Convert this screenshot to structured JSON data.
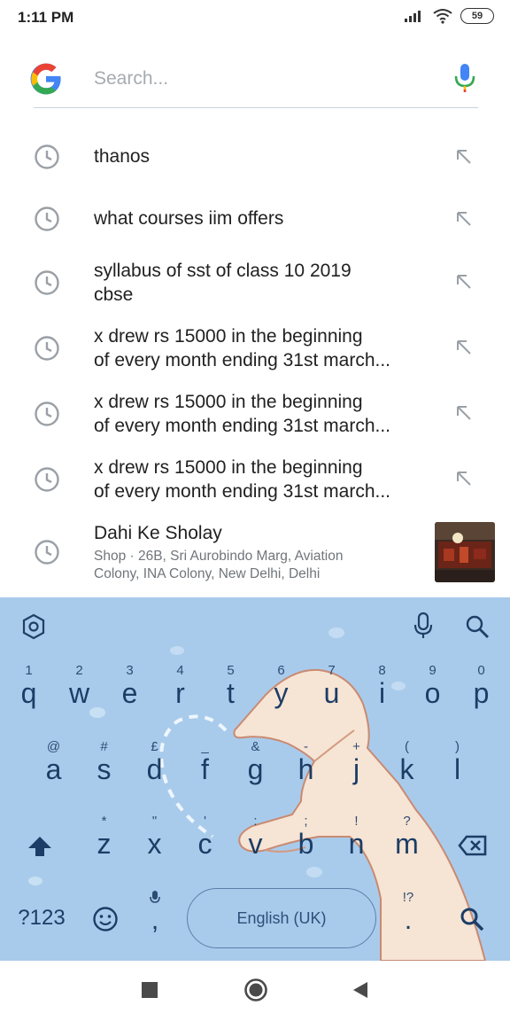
{
  "status_bar": {
    "time": "1:11 PM",
    "battery": "59"
  },
  "search": {
    "placeholder": "Search..."
  },
  "suggestions": [
    {
      "lines": [
        "thanos"
      ]
    },
    {
      "lines": [
        "what courses iim offers"
      ]
    },
    {
      "lines": [
        "syllabus of sst of class 10 2019",
        "cbse"
      ]
    },
    {
      "lines": [
        "x drew rs 15000 in the beginning",
        "of every month ending 31st march..."
      ]
    },
    {
      "lines": [
        "x drew rs 15000 in the beginning",
        "of every month ending 31st march..."
      ]
    },
    {
      "lines": [
        "x drew rs 15000 in the beginning",
        "of every month ending 31st march..."
      ]
    }
  ],
  "place": {
    "name": "Dahi Ke Sholay",
    "detail_line1": "Shop · 26B, Sri Aurobindo Marg, Aviation",
    "detail_line2": "Colony, INA Colony, New Delhi, Delhi"
  },
  "keyboard": {
    "row1": [
      {
        "k": "q",
        "h": "1"
      },
      {
        "k": "w",
        "h": "2"
      },
      {
        "k": "e",
        "h": "3"
      },
      {
        "k": "r",
        "h": "4"
      },
      {
        "k": "t",
        "h": "5"
      },
      {
        "k": "y",
        "h": "6"
      },
      {
        "k": "u",
        "h": "7"
      },
      {
        "k": "i",
        "h": "8"
      },
      {
        "k": "o",
        "h": "9"
      },
      {
        "k": "p",
        "h": "0"
      }
    ],
    "row2": [
      {
        "k": "a",
        "h": "@"
      },
      {
        "k": "s",
        "h": "#"
      },
      {
        "k": "d",
        "h": "£"
      },
      {
        "k": "f",
        "h": "_"
      },
      {
        "k": "g",
        "h": "&"
      },
      {
        "k": "h",
        "h": "-"
      },
      {
        "k": "j",
        "h": "+"
      },
      {
        "k": "k",
        "h": "("
      },
      {
        "k": "l",
        "h": ")"
      }
    ],
    "row3": [
      {
        "k": "z",
        "h": "*"
      },
      {
        "k": "x",
        "h": "\""
      },
      {
        "k": "c",
        "h": "'"
      },
      {
        "k": "v",
        "h": ":"
      },
      {
        "k": "b",
        "h": ";"
      },
      {
        "k": "n",
        "h": "!"
      },
      {
        "k": "m",
        "h": "?"
      }
    ],
    "symbols_label": "?123",
    "comma": ",",
    "period": ".",
    "period_hint": "!?",
    "space_label": "English (UK)"
  }
}
